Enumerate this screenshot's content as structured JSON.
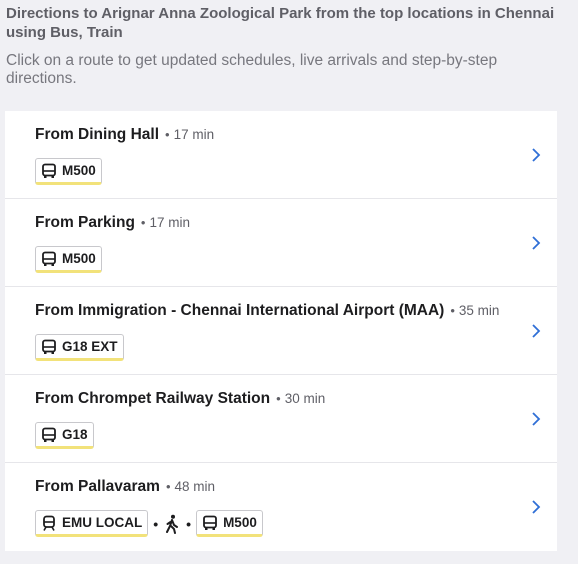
{
  "header": {
    "title": "Directions to Arignar Anna Zoological Park from the top locations in Chennai using Bus, Train",
    "subtitle": "Click on a route to get updated schedules, live arrivals and step-by-step directions."
  },
  "separator": "•",
  "routes": [
    {
      "from": "From Dining Hall",
      "duration": "17 min",
      "legs": [
        {
          "kind": "bus-icon",
          "label": "M500"
        }
      ]
    },
    {
      "from": "From Parking",
      "duration": "17 min",
      "legs": [
        {
          "kind": "bus-icon",
          "label": "M500"
        }
      ]
    },
    {
      "from": "From Immigration - Chennai International Airport (MAA)",
      "duration": "35 min",
      "legs": [
        {
          "kind": "bus-icon",
          "label": "G18 EXT"
        }
      ]
    },
    {
      "from": "From Chrompet Railway Station",
      "duration": "30 min",
      "legs": [
        {
          "kind": "bus-icon",
          "label": "G18"
        }
      ]
    },
    {
      "from": "From Pallavaram",
      "duration": "48 min",
      "legs": [
        {
          "kind": "train-icon",
          "label": "EMU LOCAL"
        },
        {
          "kind": "walk-icon"
        },
        {
          "kind": "bus-icon",
          "label": "M500"
        }
      ]
    }
  ],
  "colors": {
    "chevron": "#2f6fd6",
    "chip_underline": "#f2e27a"
  }
}
